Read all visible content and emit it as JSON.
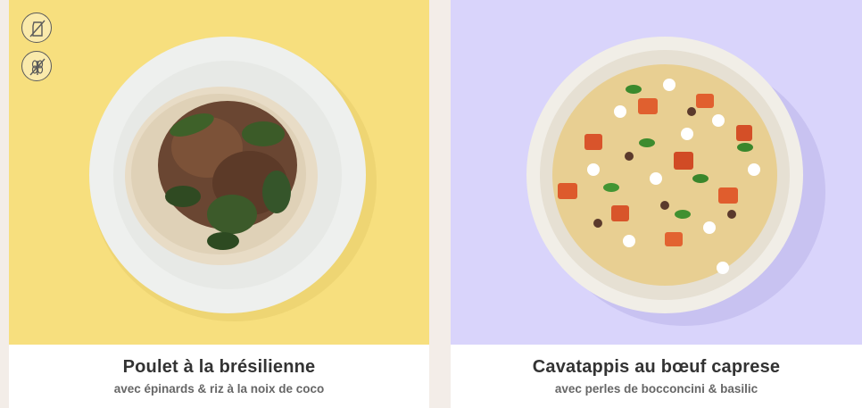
{
  "cards": [
    {
      "title": "Poulet à la brésilienne",
      "subtitle": "avec épinards & riz à la noix de coco",
      "hero_color": "#f7df7e",
      "badges": [
        "no-dairy-icon",
        "no-gluten-icon"
      ]
    },
    {
      "title": "Cavatappis au bœuf caprese",
      "subtitle": "avec perles de bocconcini & basilic",
      "hero_color": "#d9d4fb",
      "badges": []
    }
  ]
}
